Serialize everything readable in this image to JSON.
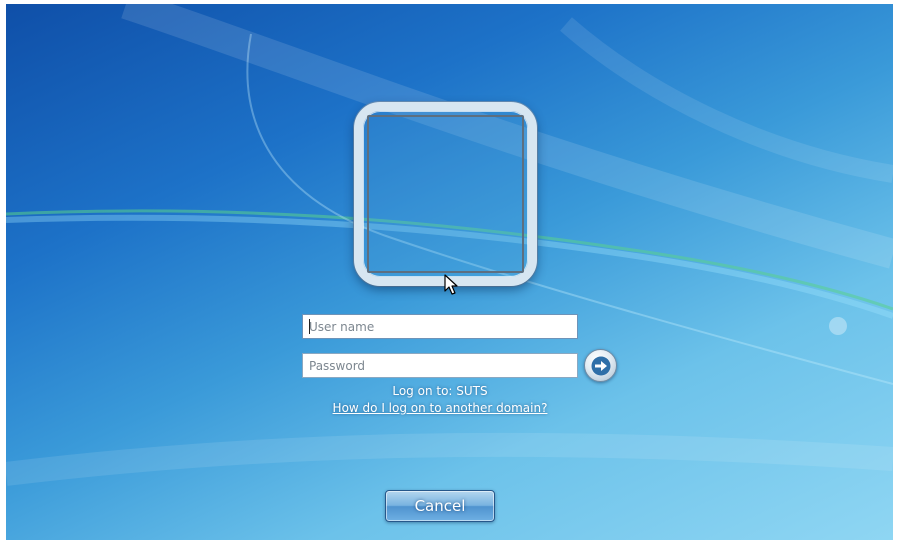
{
  "login": {
    "username_placeholder": "User name",
    "username_value": "",
    "password_placeholder": "Password",
    "password_value": "",
    "logon_to_text": "Log on to: SUTS",
    "domain_link_text": "How do I log on to another domain?",
    "submit_icon": "arrow-right-icon",
    "cancel_label": "Cancel"
  },
  "icons": {
    "user_tile": "user-picture-frame",
    "cursor": "mouse-pointer-icon"
  },
  "colors": {
    "background_top": "#0f4fa8",
    "background_bottom": "#8fd6f3",
    "cancel_button": "#4f93cf",
    "text": "#ffffff"
  }
}
